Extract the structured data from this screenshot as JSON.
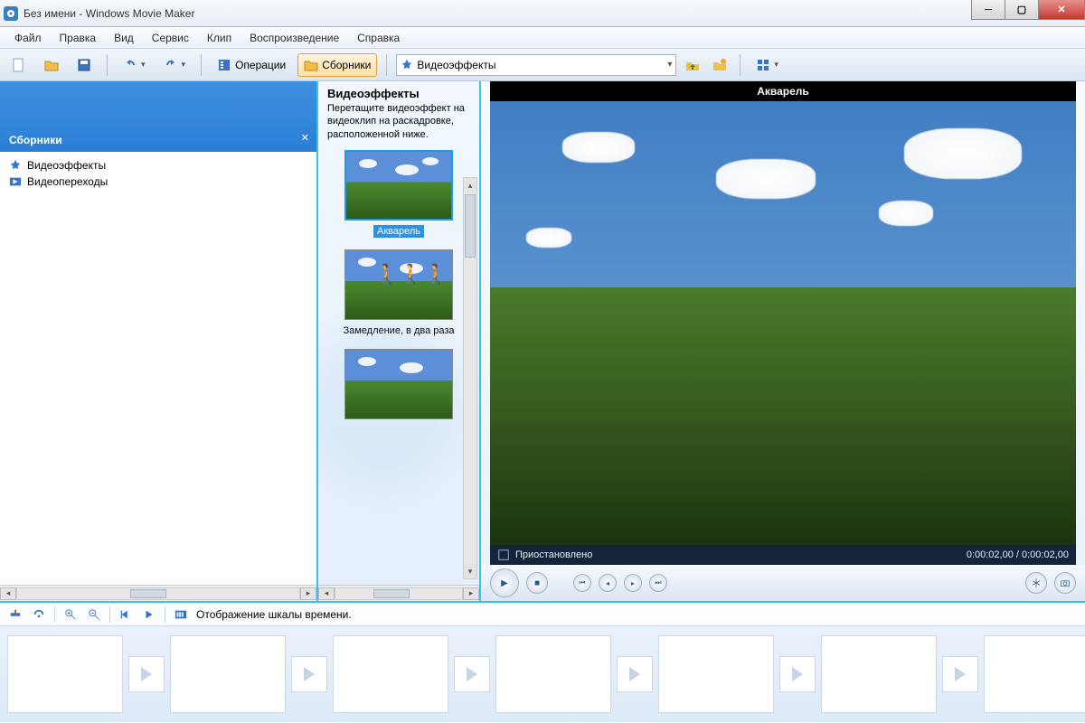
{
  "window": {
    "title": "Без имени - Windows Movie Maker"
  },
  "menu": {
    "file": "Файл",
    "edit": "Правка",
    "view": "Вид",
    "tools": "Сервис",
    "clip": "Клип",
    "play": "Воспроизведение",
    "help": "Справка"
  },
  "toolbar": {
    "operations": "Операции",
    "collections": "Сборники",
    "effects_dropdown": "Видеоэффекты"
  },
  "sidebar": {
    "title": "Сборники",
    "items": [
      {
        "label": "Видеоэффекты"
      },
      {
        "label": "Видеопереходы"
      }
    ]
  },
  "effects_panel": {
    "heading": "Видеоэффекты",
    "hint": "Перетащите видеоэффект на видеоклип на раскадровке, расположенной ниже.",
    "items": [
      {
        "label": "Акварель",
        "selected": true
      },
      {
        "label": "Замедление, в два раза",
        "selected": false
      },
      {
        "label": "",
        "selected": false
      }
    ]
  },
  "preview": {
    "clip_title": "Акварель",
    "status": "Приостановлено",
    "time_current": "0:00:02,00",
    "time_total": "0:00:02,00"
  },
  "timeline": {
    "label": "Отображение шкалы времени."
  }
}
